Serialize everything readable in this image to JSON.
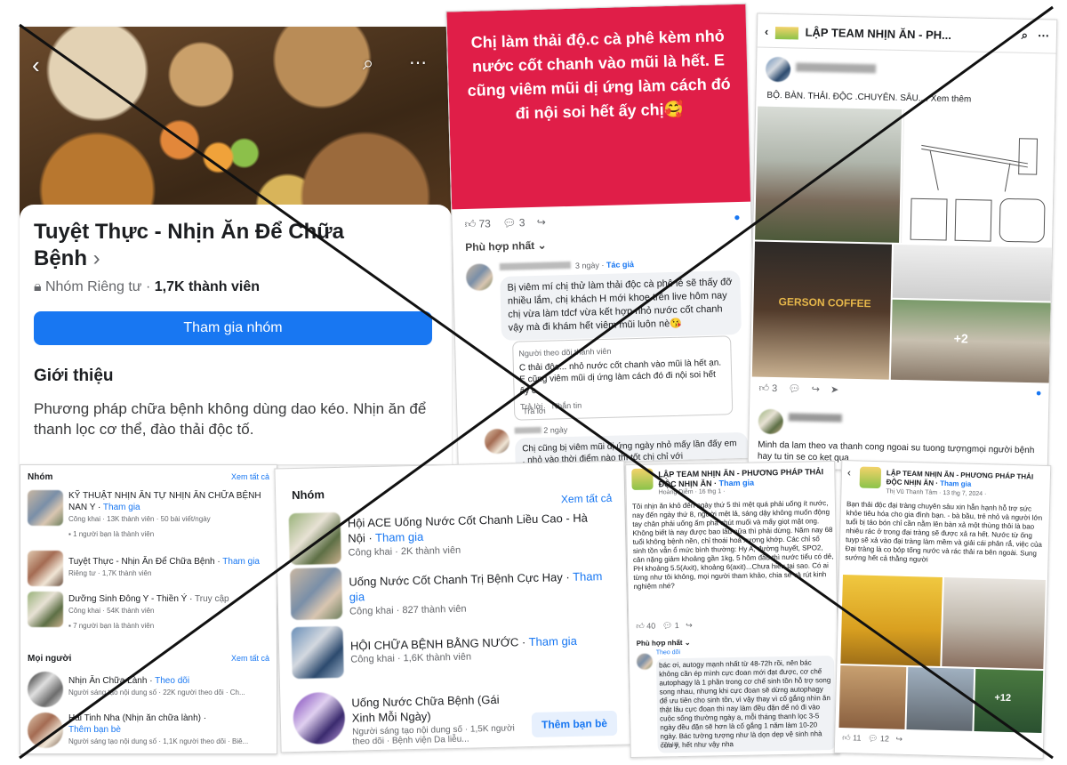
{
  "card_group": {
    "title": "Tuyệt Thực - Nhịn Ăn Để Chữa Bệnh",
    "chevron": "›",
    "privacy": "Nhóm Riêng tư ·",
    "members": "1,7K thành viên",
    "join_button": "Tham gia nhóm",
    "intro_heading": "Giới thiệu",
    "intro_text": "Phương pháp chữa bệnh không dùng dao kéo. Nhịn ăn để thanh lọc cơ thể, đào thải độc tố."
  },
  "card_red_post": {
    "text": "Chị làm thải độ.c cà phê kèm nhỏ nước cốt chanh vào mũi là hết. E cũng viêm mũi dị ứng làm cách đó đi nội soi hết ấy chị🥰",
    "likes": "73",
    "comments": "3",
    "sort": "Phù hợp nhất ⌄",
    "comment1_time": "3 ngày",
    "comment1_author_badge": "Tác giả",
    "comment1_text": "Bị viêm mí chị thử làm thải độc cà phê lẻ sẽ thấy đỡ nhiều lắm, chị khách H mới khoe trên live hôm nay chị vừa làm tdcf vừa kết hợp nhỏ nước cốt chanh vậy mà đi khám hết viêm mũi luôn nè😘",
    "reply_header": "Người theo dõi thành viên",
    "reply_text": "C thải độc... nhỏ nước cốt chanh vào mũi là hết ạn. E cũng viêm mũi dị ứng làm cách đó đi nội soi hết ấy c",
    "reply_actions": [
      "Trả lời",
      "Nhắn tin"
    ],
    "comment2_time": "2 ngày",
    "comment2_text": "Chị cũng bị viêm mũi dị ứng ngày nhỏ mấy lần đấy em , nhỏ vào thời điểm nào thì tốt chị chỉ với",
    "comment2_action": "Trả lời"
  },
  "card_team_post": {
    "header": "LẬP TEAM NHỊN ĂN - PH...",
    "caption": "BỘ. BÀN. THẢI. ĐỘC .CHUYÊN. SÂU.... Xem thêm",
    "photo_more": "+2",
    "coffee_label": "GERSON COFFEE",
    "likes": "3",
    "comment_text": "Minh da lam theo va  thanh cong ngoai su tuong tượngmọi người bệnh hay tu tin se co ket qua"
  },
  "card_groups_list": {
    "heading": "Nhóm",
    "see_all": "Xem tất cả",
    "items": [
      {
        "name": "KỸ THUẬT NHỊN ĂN TỰ  NHỊN ĂN CHỮA BỆNH NAN Y",
        "join": "Tham gia",
        "meta": "Công khai · 13K thành viên · 50 bài viết/ngày",
        "friend": "1 người bạn là thành viên"
      },
      {
        "name": "Tuyệt Thực - Nhịn Ăn Để Chữa Bệnh ·",
        "join": "Tham gia",
        "meta": "Riêng tư · 1,7K thành viên"
      },
      {
        "name": "Dưỡng Sinh Đông Y - Thiền Ý · ",
        "join": "Truy cập",
        "meta": "Công khai · 54K thành viên",
        "friend": "7 người bạn là thành viên"
      }
    ],
    "people_heading": "Mọi người",
    "people": [
      {
        "name": "Nhịn Ăn Chữa Lành ·",
        "follow": "Theo dõi",
        "meta": "Người sáng tạo nội dung số · 22K người theo dõi · Ch..."
      },
      {
        "name": "Hai Tinh Nha (Nhịn ăn chữa lành) ·",
        "follow": "Thêm bạn bè",
        "meta": "Người sáng tạo nội dung số · 1,1K người theo dõi · Biê..."
      }
    ]
  },
  "card_groups_big": {
    "heading": "Nhóm",
    "see_all": "Xem tất cả",
    "items": [
      {
        "name": "Hội ACE Uống Nước Cốt Chanh Liều Cao - Hà Nội ·",
        "join": "Tham gia",
        "meta": "Công khai · 2K thành viên"
      },
      {
        "name": "Uống Nước Cốt Chanh Trị Bệnh Cực Hay ·",
        "join": "Tham gia",
        "meta": "Công khai · 827 thành viên"
      },
      {
        "name": "HỘI CHỮA BỆNH BẰNG NƯỚC ·",
        "join": "Tham gia",
        "meta": "Công khai · 1,6K thành viên"
      },
      {
        "name": "Uống Nước Chữa Bệnh (Gái Xinh Mỗi Ngày)",
        "meta": "Người sáng tạo nội dung số · 1,5K người theo dõi · Bệnh viện Da liễu..."
      }
    ],
    "add_friend": "Thêm bạn bè"
  },
  "card_post_a": {
    "group": "LẬP TEAM NHỊN ĂN - PHƯƠNG PHÁP THẢI ĐỘC NHỊN ĂN",
    "join": "Tham gia",
    "time": "Hoàng Diễm · 16 thg 1 ·",
    "body": "Tôi nhịn ăn khô đến ngày thứ 5 thì mệt quá phải uống ít nước, nay đến ngày thứ 8, người mệt lả, sáng dậy không muốn động tay chân phải uống ấm pha chút muối và mấy giọt mật ong. Không biết là nay được bao lâu nữa thì phải dừng. Năm nay 68 tuổi không bệnh nền, chỉ thoái hoá xương khớp. Các chỉ số sinh tồn vẫn ổ mức bình thường: Hy A, đường huyết, SPO2, cân nặng giảm khoảng gần 1kg, 5 hôm đầu thì nước tiểu có dẻ, PH khoảng 5.5(Axit), khoảng 6(axit)...Chưa hiểu tại sao. Có ai từng như tôi không, mọi người tham khảo, chia sẻ và rút kinh nghiệm nhé?",
    "likes": "40",
    "comments": "1",
    "sort": "Phù hợp nhất ⌄",
    "reply": "bác ơi, autogy mạnh nhất từ 48-72h rồi, nên bác không cần ép mình cực đoan mới đạt được, cơ chế autophagy là 1 phần trong cơ chế sinh tồn hỗ trợ song song nhau, nhưng khi cực đoan sẽ dừng autophagy để ưu tiên cho sinh tồn, vì vậy thay vì cố gắng nhìn ăn thật lâu cực đoan thì nay làm đều đặn để nó đi vào cuộc sống thường ngày ạ, mỗi tháng thanh lọc 3-5 ngày đều đặn sẽ hơn là cố gắng 1 năm làm 10-20 ngày. Bác tường tượng như là dọn dẹp vệ sinh nhà cửa ý, hết như vậy nha",
    "reply_time": "Theo dõi",
    "reply_action": "Trả lời"
  },
  "card_post_b": {
    "group": "LẬP TEAM NHỊN ĂN - PHƯƠNG PHÁP THẢI ĐỘC NHỊN ĂN",
    "join": "Tham gia",
    "time": "Thị Vũ Thanh Tâm · 13 thg 7, 2024 ·",
    "body": "Bạn thải độc đại tràng chuyên sâu xin hẫn hạnh hỗ trợ sức khỏe tiêu hóa cho gia đình bạn. - bà bầu, trẻ nhỏ và người lớn tuổi bị táo bón chỉ cần nằm lên bàn xả một thùng thôi là bao nhiêu rác ở trong đại tràng sẽ được xả ra hết. Nước từ ống tuyp sẽ xả vào đại tràng làm mềm và giải cái phân rắ, việc của Đại tràng là co bóp tống nước và rác thải ra bên ngoài. Sung sướng hết cả thằng người",
    "photo_more": "+12",
    "likes": "11",
    "comments": "12"
  },
  "colors": {
    "brand_blue": "#1877f2",
    "red_post": "#e01e48",
    "cross": "#111111"
  }
}
